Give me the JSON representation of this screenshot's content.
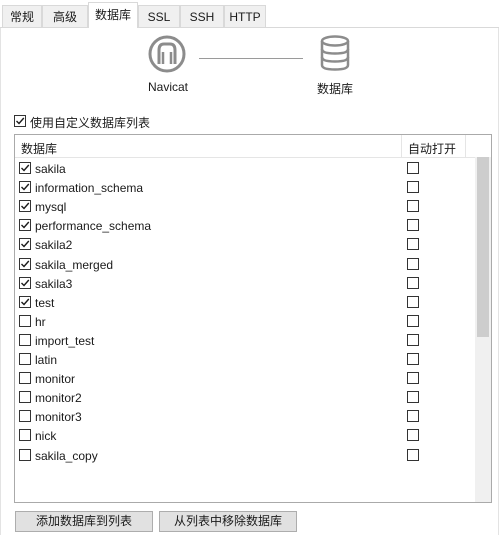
{
  "tabs": [
    {
      "label": "常规",
      "active": false
    },
    {
      "label": "高级",
      "active": false
    },
    {
      "label": "数据库",
      "active": true
    },
    {
      "label": "SSL",
      "active": false
    },
    {
      "label": "SSH",
      "active": false
    },
    {
      "label": "HTTP",
      "active": false
    }
  ],
  "diagram": {
    "left_label": "Navicat",
    "right_label": "数据库",
    "left_icon": "navicat-logo-icon",
    "right_icon": "database-icon"
  },
  "use_custom_list": {
    "label": "使用自定义数据库列表",
    "checked": true
  },
  "list": {
    "col_database": "数据库",
    "col_auto_open": "自动打开",
    "rows": [
      {
        "name": "sakila",
        "checked": true,
        "auto_open": false
      },
      {
        "name": "information_schema",
        "checked": true,
        "auto_open": false
      },
      {
        "name": "mysql",
        "checked": true,
        "auto_open": false
      },
      {
        "name": "performance_schema",
        "checked": true,
        "auto_open": false
      },
      {
        "name": "sakila2",
        "checked": true,
        "auto_open": false
      },
      {
        "name": "sakila_merged",
        "checked": true,
        "auto_open": false
      },
      {
        "name": "sakila3",
        "checked": true,
        "auto_open": false
      },
      {
        "name": "test",
        "checked": true,
        "auto_open": false
      },
      {
        "name": "hr",
        "checked": false,
        "auto_open": false
      },
      {
        "name": "import_test",
        "checked": false,
        "auto_open": false
      },
      {
        "name": "latin",
        "checked": false,
        "auto_open": false
      },
      {
        "name": "monitor",
        "checked": false,
        "auto_open": false
      },
      {
        "name": "monitor2",
        "checked": false,
        "auto_open": false
      },
      {
        "name": "monitor3",
        "checked": false,
        "auto_open": false
      },
      {
        "name": "nick",
        "checked": false,
        "auto_open": false
      },
      {
        "name": "sakila_copy",
        "checked": false,
        "auto_open": false
      }
    ]
  },
  "buttons": {
    "add": "添加数据库到列表",
    "remove": "从列表中移除数据库"
  }
}
